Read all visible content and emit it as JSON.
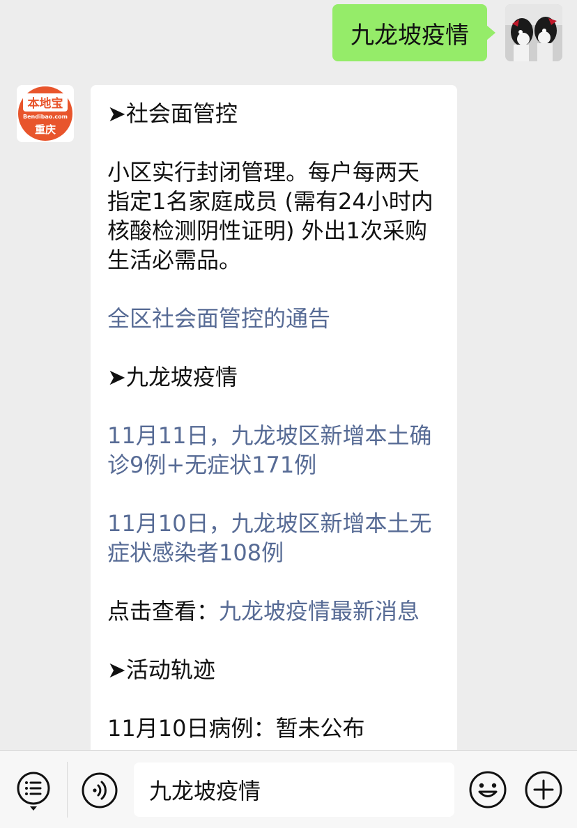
{
  "outgoing": {
    "text": "九龙坡疫情"
  },
  "incoming": {
    "avatar": {
      "logo_text": "本地宝",
      "logo_sub": "Bendibao.com",
      "city": "重庆",
      "color": "#e8552c"
    },
    "paragraphs": [
      {
        "text": "➤社会面管控",
        "type": "heading"
      },
      {
        "text": "小区实行封闭管理。每户每两天指定1名家庭成员 (需有24小时内核酸检测阴性证明) 外出1次采购生活必需品。",
        "type": "text"
      },
      {
        "text": "全区社会面管控的通告",
        "type": "link"
      },
      {
        "text": "➤九龙坡疫情",
        "type": "heading"
      },
      {
        "text": "11月11日，九龙坡区新增本土确诊9例+无症状171例",
        "type": "link"
      },
      {
        "text": "11月10日，九龙坡区新增本土无症状感染者108例",
        "type": "link"
      },
      {
        "prefix": "点击查看：",
        "link": "九龙坡疫情最新消息",
        "type": "mixed"
      },
      {
        "text": "➤活动轨迹",
        "type": "heading"
      },
      {
        "text": "11月10日病例：暂未公布",
        "type": "text"
      }
    ]
  },
  "input_bar": {
    "value": "九龙坡疫情",
    "icons": [
      "menu-list-icon",
      "voice-icon",
      "emoji-icon",
      "plus-icon"
    ]
  },
  "colors": {
    "outgoing_bubble": "#95ec69",
    "link": "#576b95",
    "background": "#ededed"
  }
}
